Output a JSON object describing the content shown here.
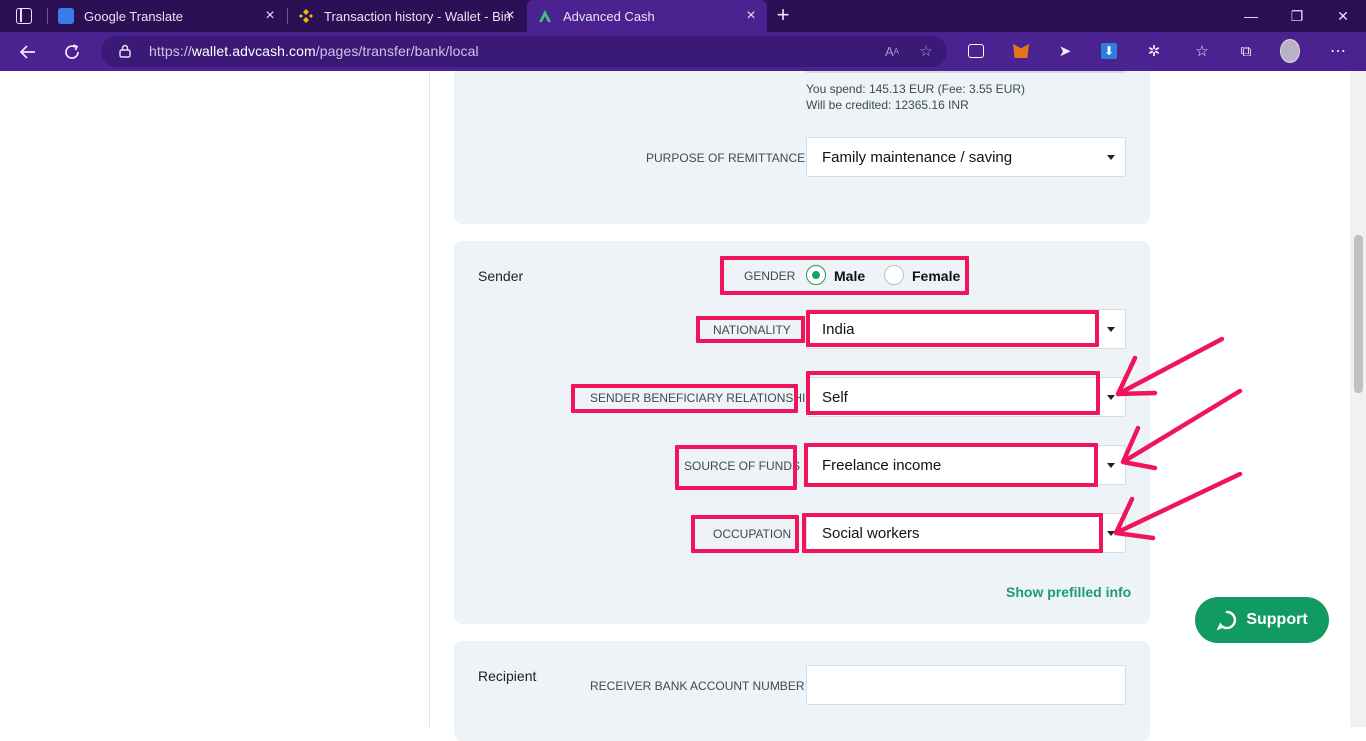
{
  "browser": {
    "tabs": [
      {
        "title": "Google Translate",
        "active": false
      },
      {
        "title": "Transaction history - Wallet - Bin",
        "active": false
      },
      {
        "title": "Advanced Cash",
        "active": true
      }
    ],
    "new_tab": "+",
    "address": {
      "prefix": "https://",
      "host": "wallet.advcash.com",
      "path": "/pages/transfer/bank/local"
    },
    "window_controls": {
      "minimize": "—",
      "restore": "❐",
      "close": "✕"
    }
  },
  "transfer": {
    "spend_note": "You spend: 145.13 EUR (Fee: 3.55 EUR)",
    "credit_note": "Will be credited: 12365.16 INR",
    "purpose_label": "PURPOSE OF REMITTANCE",
    "purpose_value": "Family maintenance / saving"
  },
  "sender": {
    "title": "Sender",
    "gender_label": "GENDER",
    "gender_options": [
      "Male",
      "Female"
    ],
    "gender_selected": "Male",
    "nationality_label": "NATIONALITY",
    "nationality_value": "India",
    "relationship_label": "SENDER BENEFICIARY RELATIONSHIP",
    "relationship_value": "Self",
    "funds_label": "SOURCE OF FUNDS",
    "funds_value": "Freelance income",
    "occupation_label": "OCCUPATION",
    "occupation_value": "Social workers",
    "prefilled_link": "Show prefilled info"
  },
  "recipient": {
    "title": "Recipient",
    "account_label": "RECEIVER BANK ACCOUNT NUMBER",
    "account_value": ""
  },
  "support_button": "Support",
  "annotation_color": "#f0145a",
  "accent_color": "#1a9e6a"
}
